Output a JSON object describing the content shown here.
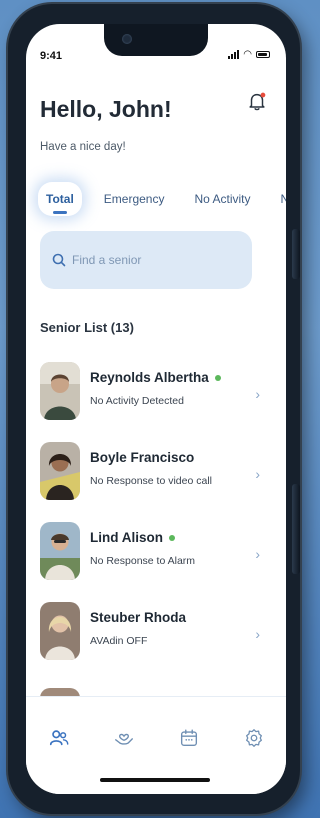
{
  "status_bar": {
    "time": "9:41"
  },
  "header": {
    "greeting": "Hello, John!",
    "subtitle": "Have a nice day!"
  },
  "tabs": [
    {
      "label": "Total",
      "active": true
    },
    {
      "label": "Emergency",
      "active": false
    },
    {
      "label": "No Activity",
      "active": false
    },
    {
      "label": "No",
      "active": false
    }
  ],
  "search": {
    "placeholder": "Find a senior"
  },
  "senior_list": {
    "title": "Senior List (13)",
    "items": [
      {
        "name": "Reynolds Albertha",
        "status": "No Activity Detected",
        "online": true
      },
      {
        "name": "Boyle Francisco",
        "status": "No Response to video call",
        "online": false
      },
      {
        "name": "Lind Alison",
        "status": "No Response to Alarm",
        "online": true
      },
      {
        "name": "Steuber Rhoda",
        "status": "AVAdin OFF",
        "online": false
      }
    ]
  },
  "nav_icons": [
    "people-icon",
    "heart-hand-icon",
    "calendar-icon",
    "settings-icon"
  ],
  "colors": {
    "accent": "#2c5f9e",
    "online": "#5cb85c",
    "search_bg": "#dde9f6"
  }
}
